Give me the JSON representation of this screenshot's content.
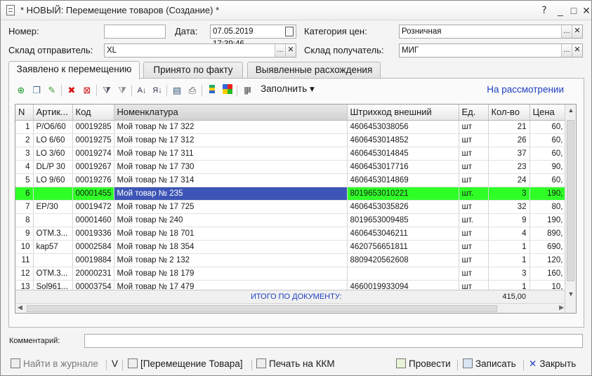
{
  "window": {
    "title": "* НОВЫЙ: Перемещение товаров (Создание) *",
    "help": "?",
    "minimize": "_",
    "maximize": "□",
    "close": "✕"
  },
  "form": {
    "number_label": "Номер:",
    "number_value": "",
    "date_label": "Дата:",
    "date_value": "07.05.2019 17:39:46",
    "price_category_label": "Категория цен:",
    "price_category_value": "Розничная",
    "sender_label": "Склад отправитель:",
    "sender_value": "XL",
    "receiver_label": "Склад получатель:",
    "receiver_value": "МИГ",
    "select_btn": "...",
    "clear_btn": "✕"
  },
  "tabs": [
    {
      "label": "Заявлено к перемещению"
    },
    {
      "label": "Принято по факту"
    },
    {
      "label": "Выявленные расхождения"
    }
  ],
  "toolbar": {
    "fill_label": "Заполнить ▾",
    "status_link": "На рассмотрении"
  },
  "grid": {
    "columns": [
      "N",
      "Артик...",
      "Код",
      "Номенклатура",
      "Штрихкод внешний",
      "Ед.",
      "Кол-во",
      "Цена"
    ],
    "rows": [
      [
        "1",
        "P/O6/60",
        "00019285",
        "Мой товар № 17 322",
        "4606453038056",
        "шт",
        "21",
        "60,"
      ],
      [
        "2",
        "LO 6/60",
        "00019275",
        "Мой товар № 17 312",
        "4606453014852",
        "шт",
        "26",
        "60,"
      ],
      [
        "3",
        "LO 3/60",
        "00019274",
        "Мой товар № 17 311",
        "4606453014845",
        "шт",
        "37",
        "60,"
      ],
      [
        "4",
        "DL/P 30",
        "00019267",
        "Мой товар № 17 730",
        "4606453017716",
        "шт",
        "23",
        "90,"
      ],
      [
        "5",
        "LO 9/60",
        "00019276",
        "Мой товар № 17 314",
        "4606453014869",
        "шт",
        "24",
        "60,"
      ],
      [
        "6",
        "",
        "00001455",
        "Мой товар № 235",
        "8019653010221",
        "шт.",
        "3",
        "190,"
      ],
      [
        "7",
        "EP/30",
        "00019472",
        "Мой товар № 17 725",
        "4606453035826",
        "шт",
        "32",
        "80,"
      ],
      [
        "8",
        "",
        "00001460",
        "Мой товар № 240",
        "8019653009485",
        "шт.",
        "9",
        "190,"
      ],
      [
        "9",
        "OTM.3...",
        "00019336",
        "Мой товар № 18 701",
        "4606453046211",
        "шт",
        "4",
        "890,"
      ],
      [
        "10",
        "kap57",
        "00002584",
        "Мой товар № 18 354",
        "4620756651811",
        "шт",
        "1",
        "690,"
      ],
      [
        "11",
        "",
        "00019884",
        "Мой товар № 2 132",
        "8809420562608",
        "шт",
        "1",
        "120,"
      ],
      [
        "12",
        "OTM.3...",
        "20000231",
        "Мой товар № 18 179",
        "",
        "шт",
        "3",
        "160,"
      ],
      [
        "13",
        "Sol961...",
        "00003754",
        "Мой товар № 17 479",
        "4660019933094",
        "шт",
        "1",
        "10,"
      ]
    ],
    "totals_label": "ИТОГО ПО ДОКУМЕНТУ:",
    "totals_qty": "415,00"
  },
  "comment": {
    "label": "Комментарий:",
    "value": ""
  },
  "bottom": {
    "journal": "Найти в журнале",
    "v": "V",
    "print_doc": "[Перемещение Товара]",
    "print_kkm": "Печать на ККМ",
    "post": "Провести",
    "save": "Записать",
    "close": "Закрыть"
  },
  "colors": {
    "selected_row": "#2fff27",
    "current_cell": "#3d55b6",
    "link": "#1f3fbf"
  }
}
